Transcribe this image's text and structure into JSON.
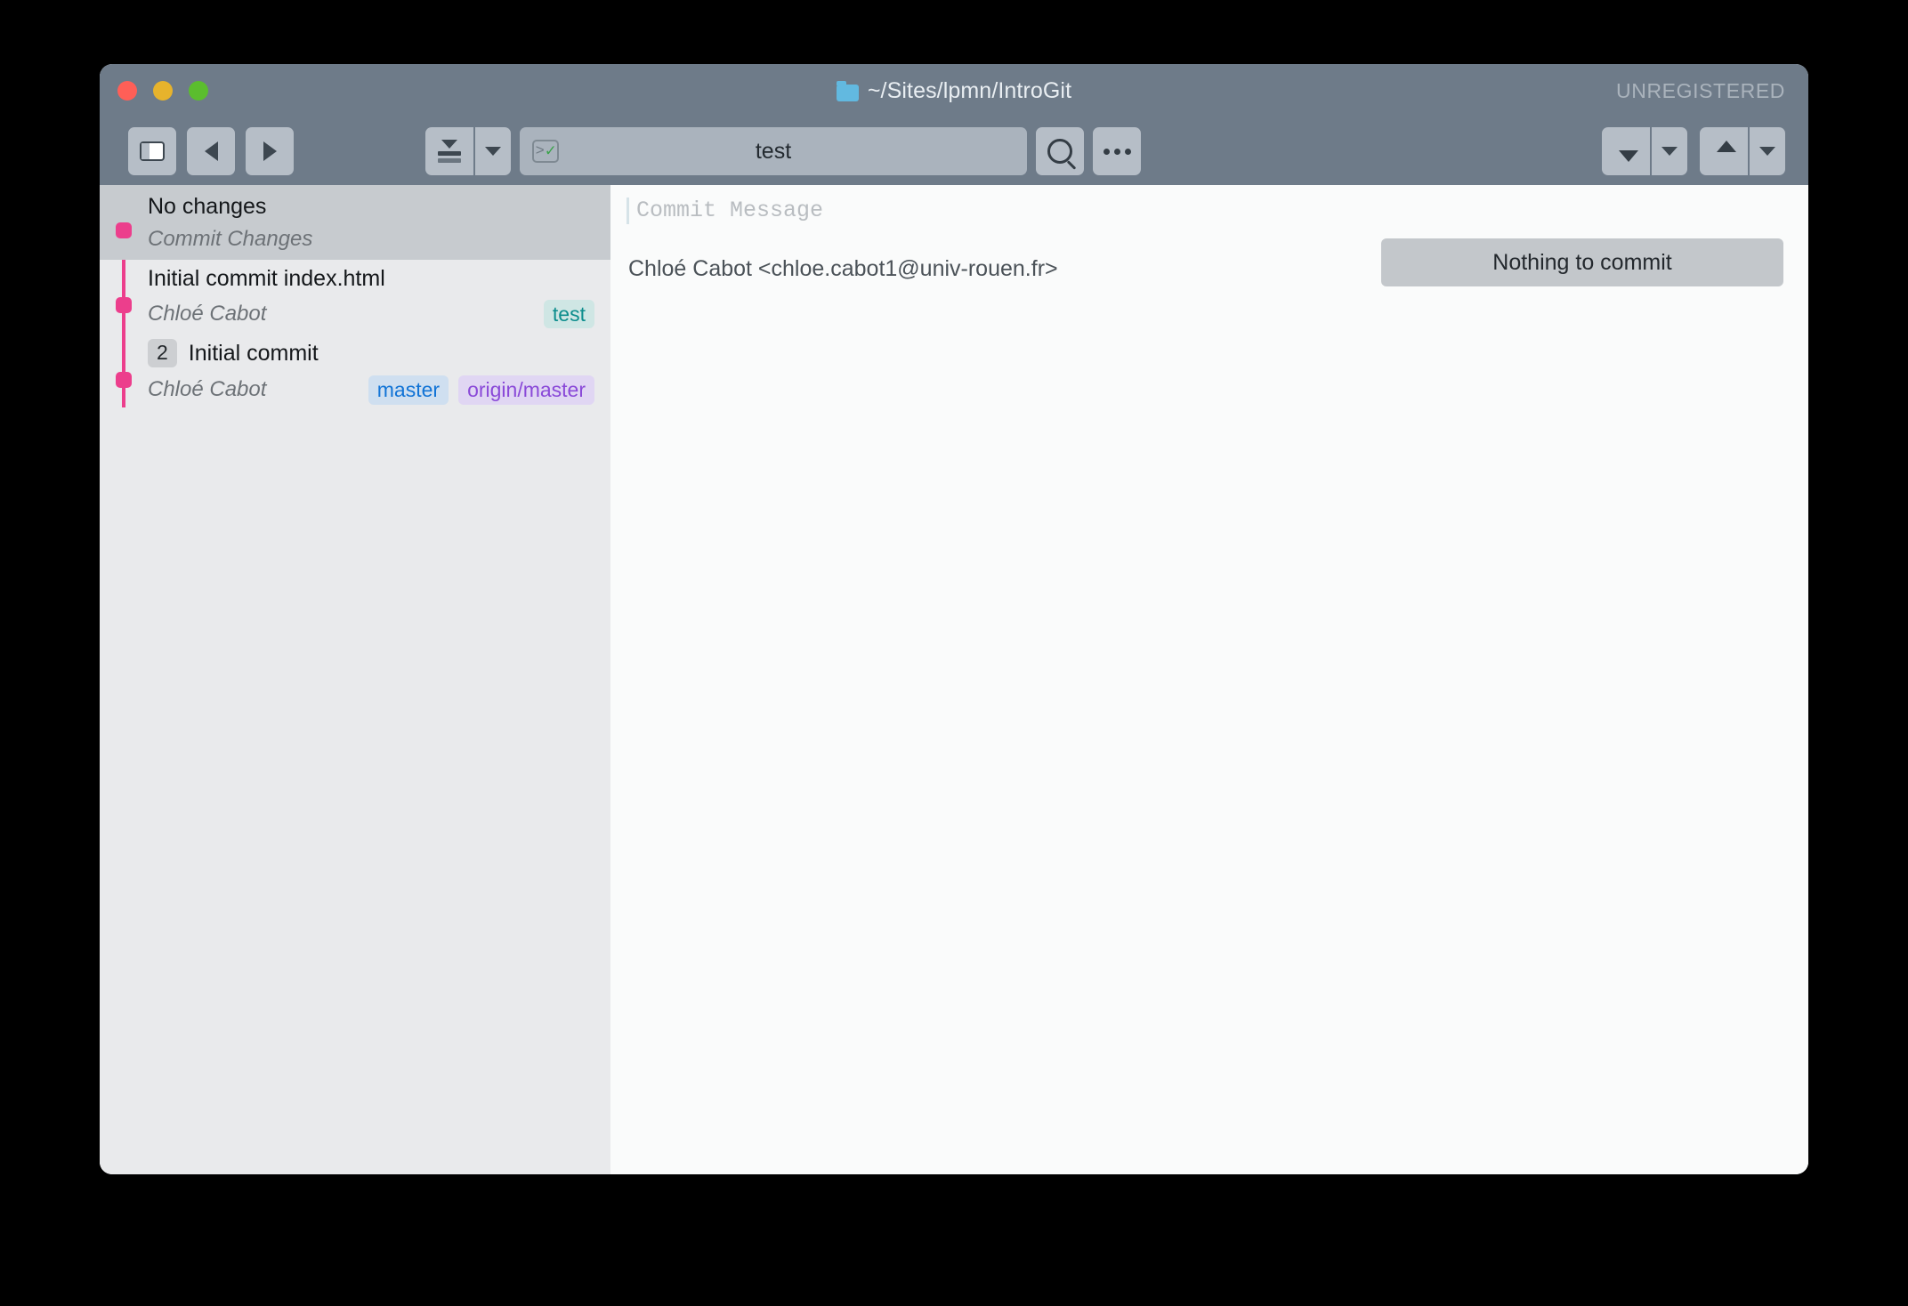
{
  "window": {
    "title": "~/Sites/lpmn/IntroGit",
    "folder_icon": "folder-icon",
    "license_status": "UNREGISTERED",
    "traffic_lights": {
      "close_color": "#ff5f57",
      "minimize_color": "#e7b32c",
      "zoom_color": "#5bbd2e"
    }
  },
  "toolbar": {
    "sidebar_toggle_icon": "sidebar-toggle-icon",
    "back_icon": "back-arrow-icon",
    "forward_icon": "forward-arrow-icon",
    "branch_icon": "branch-collapse-icon",
    "branch_dropdown_icon": "chevron-down-icon",
    "search_value": "test",
    "search_prefix_icon": "terminal-check-icon",
    "search_icon": "magnifier-icon",
    "more_icon": "ellipsis-icon",
    "pull_icon": "arrow-down-icon",
    "pull_dropdown_icon": "chevron-down-icon",
    "push_icon": "arrow-up-icon",
    "push_dropdown_icon": "chevron-down-icon"
  },
  "sidebar": {
    "commits": [
      {
        "title": "No changes",
        "author": "Commit Changes",
        "count": null,
        "selected": true,
        "refs": []
      },
      {
        "title": "Initial commit index.html",
        "author": "Chloé Cabot",
        "count": null,
        "selected": false,
        "refs": [
          {
            "label": "test",
            "style": "teal"
          }
        ]
      },
      {
        "title": "Initial commit",
        "author": "Chloé Cabot",
        "count": "2",
        "selected": false,
        "refs": [
          {
            "label": "master",
            "style": "blue"
          },
          {
            "label": "origin/master",
            "style": "purple"
          }
        ]
      }
    ],
    "graph_color": "#ec3e8c"
  },
  "content": {
    "commit_message_placeholder": "Commit Message",
    "commit_author": "Chloé Cabot <chloe.cabot1@univ-rouen.fr>",
    "commit_button_label": "Nothing to commit",
    "placeholder_blocks": 3
  }
}
